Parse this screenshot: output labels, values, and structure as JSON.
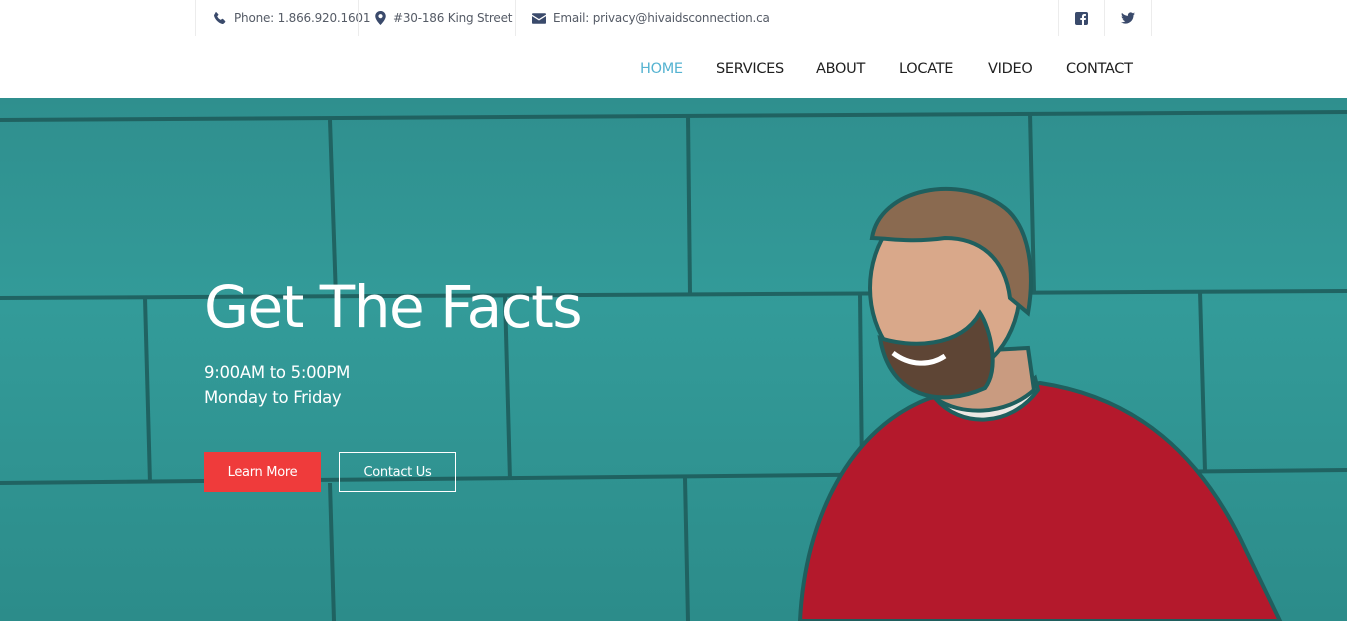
{
  "topbar": {
    "phone": "Phone: 1.866.920.1601",
    "address": "#30-186 King Street",
    "email": "Email: privacy@hivaidsconnection.ca",
    "social": [
      "facebook-icon",
      "twitter-icon"
    ]
  },
  "nav": {
    "items": [
      "HOME",
      "SERVICES",
      "ABOUT",
      "LOCATE",
      "VIDEO",
      "CONTACT"
    ],
    "active": "HOME"
  },
  "hero": {
    "title": "Get The Facts",
    "hours_line1": "9:00AM to 5:00PM",
    "hours_line2": "Monday to Friday",
    "primary_button": "Learn More",
    "secondary_button": "Contact Us"
  },
  "colors": {
    "accent_nav": "#55b3d1",
    "primary_button": "#ef3b3b",
    "hero_teal": "#339b99",
    "icon": "#3a4a6b"
  }
}
